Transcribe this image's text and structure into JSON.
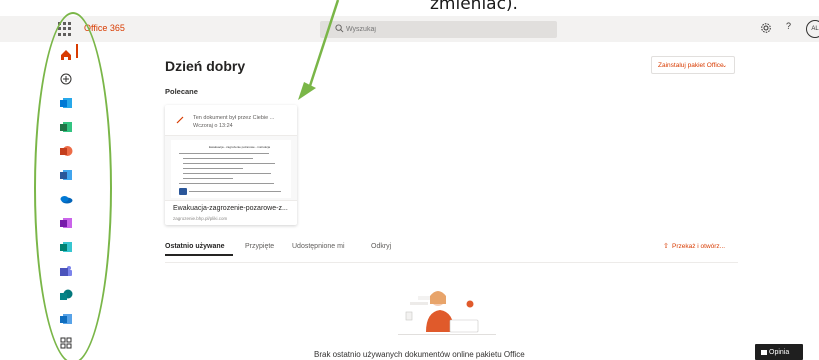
{
  "caption": {
    "text": "zmieniać)."
  },
  "header": {
    "app_name": "Office 365",
    "search_placeholder": "Wyszukaj",
    "help_label": "?",
    "avatar_initials": "AL"
  },
  "rail": {
    "items": [
      {
        "icon": "home-icon",
        "color": "#d83b01"
      },
      {
        "icon": "create-icon",
        "color": "#323130"
      },
      {
        "icon": "outlook-icon",
        "color": "#0078d4"
      },
      {
        "icon": "excel-icon",
        "color": "#217346"
      },
      {
        "icon": "powerpoint-icon",
        "color": "#d24726"
      },
      {
        "icon": "word-icon",
        "color": "#2b579a"
      },
      {
        "icon": "onedrive-icon",
        "color": "#0364b8"
      },
      {
        "icon": "onenote-icon",
        "color": "#7719aa"
      },
      {
        "icon": "sway-icon",
        "color": "#008272"
      },
      {
        "icon": "teams-icon",
        "color": "#4b53bc"
      },
      {
        "icon": "sharepoint-icon",
        "color": "#038387"
      },
      {
        "icon": "yammer-icon",
        "color": "#106ebe"
      },
      {
        "icon": "all-apps-icon",
        "color": "#323130"
      }
    ]
  },
  "main": {
    "greeting": "Dzień dobry",
    "install_label": "Zainstaluj pakiet Office",
    "recommended_label": "Polecane",
    "card": {
      "action_line1": "Ten dokument był przez Ciebie ...",
      "action_line2": "Wczoraj o 13:24",
      "thumb_title": "Ewakuacja - zagrożenie pożarowe - instrukcja",
      "name": "Ewakuacja-zagrozenie-pozarowe-z...",
      "location": "zagrozenie.bhp.pl/pliki.com"
    },
    "tabs": [
      "Ostatnio używane",
      "Przypięte",
      "Udostępnione mi",
      "Odkryj"
    ],
    "upload_label": "Przekaż i otwórz...",
    "empty_text": "Brak ostatnio używanych dokumentów online pakietu Office"
  },
  "feedback_label": "Opinia",
  "colors": {
    "accent": "#d83b01",
    "annotation_green": "#7ab648"
  }
}
